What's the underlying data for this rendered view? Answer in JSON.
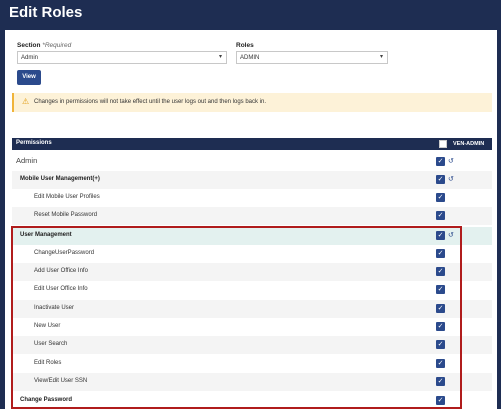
{
  "page": {
    "title": "Edit Roles"
  },
  "form": {
    "section_label": "Section",
    "section_required": "*Required",
    "section_value": "Admin",
    "roles_label": "Roles",
    "roles_value": "ADMIN",
    "view_button": "View"
  },
  "warning": {
    "text": "Changes in permissions will not take effect until the user logs out and then logs back in."
  },
  "table": {
    "header": "Permissions",
    "role_column": "VEN-ADMIN",
    "rows": [
      {
        "label": "Admin",
        "checked": true,
        "history": true
      },
      {
        "label": "Mobile User Management(+)",
        "checked": true,
        "history": true
      },
      {
        "label": "Edit Mobile User Profiles",
        "checked": true,
        "history": false
      },
      {
        "label": "Reset Mobile Password",
        "checked": true,
        "history": false
      },
      {
        "label": "User Management",
        "checked": true,
        "history": true
      },
      {
        "label": "ChangeUserPassword",
        "checked": true,
        "history": false
      },
      {
        "label": "Add User Office Info",
        "checked": true,
        "history": false
      },
      {
        "label": "Edit User Office Info",
        "checked": true,
        "history": false
      },
      {
        "label": "Inactivate User",
        "checked": true,
        "history": false
      },
      {
        "label": "New User",
        "checked": true,
        "history": false
      },
      {
        "label": "User Search",
        "checked": true,
        "history": false
      },
      {
        "label": "Edit Roles",
        "checked": true,
        "history": false
      },
      {
        "label": "View/Edit User SSN",
        "checked": true,
        "history": false
      },
      {
        "label": "Change Password",
        "checked": true,
        "history": false
      }
    ]
  },
  "icons": {
    "checkbox": "checkbox-checked-icon",
    "history": "history-icon",
    "warning": "warning-icon",
    "dropdown": "chevron-down-icon"
  },
  "colors": {
    "header_bg": "#1e2d52",
    "accent": "#2b4a8c",
    "highlight_row": "#e3f1ef",
    "warning_bg": "#fdf2d8",
    "annotation_border": "#b01c1c"
  }
}
